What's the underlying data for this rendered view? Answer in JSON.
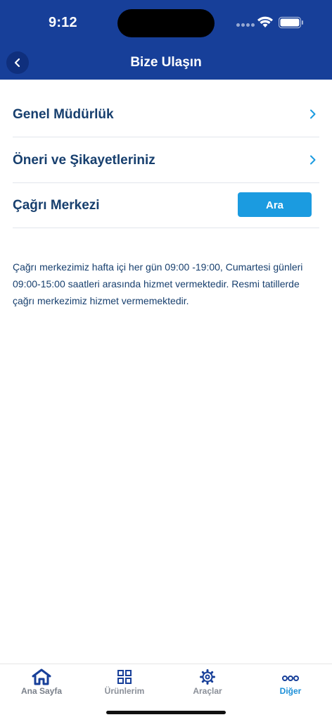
{
  "status_bar": {
    "time": "9:12"
  },
  "header": {
    "title": "Bize Ulaşın"
  },
  "menu": {
    "items": [
      {
        "label": "Genel Müdürlük"
      },
      {
        "label": "Öneri ve Şikayetleriniz"
      },
      {
        "label": "Çağrı Merkezi",
        "button_label": "Ara"
      }
    ]
  },
  "info": {
    "text": "Çağrı merkezimiz hafta içi her gün 09:00 -19:00, Cumartesi günleri 09:00-15:00 saatleri arasında hizmet vermektedir. Resmi tatillerde çağrı merkezimiz hizmet vermemektedir."
  },
  "tabbar": {
    "tabs": [
      {
        "label": "Ana Sayfa",
        "icon": "home-icon"
      },
      {
        "label": "Ürünlerim",
        "icon": "grid-icon"
      },
      {
        "label": "Araçlar",
        "icon": "gear-icon"
      },
      {
        "label": "Diğer",
        "icon": "more-dots-icon",
        "active": true
      }
    ]
  },
  "colors": {
    "header_bg": "#173f99",
    "text_primary": "#173f6e",
    "accent": "#1b9be0"
  }
}
